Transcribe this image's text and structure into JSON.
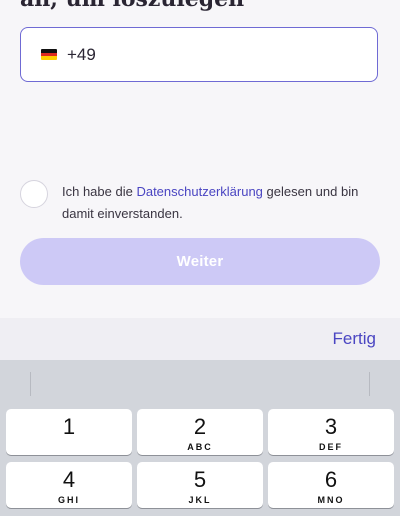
{
  "heading_fragment": "an, um loszulegen",
  "phone": {
    "country_flag_icon": "flag-germany-icon",
    "prefix": "+49"
  },
  "consent": {
    "text_before": "Ich habe die ",
    "link": "Datenschutzerklärung",
    "text_after": " gelesen und bin damit einverstanden.",
    "checked": false
  },
  "continue_button": "Weiter",
  "keyboard": {
    "done": "Fertig",
    "keys": [
      {
        "num": "1",
        "letters": ""
      },
      {
        "num": "2",
        "letters": "ABC"
      },
      {
        "num": "3",
        "letters": "DEF"
      },
      {
        "num": "4",
        "letters": "GHI"
      },
      {
        "num": "5",
        "letters": "JKL"
      },
      {
        "num": "6",
        "letters": "MNO"
      }
    ]
  },
  "colors": {
    "accent": "#4a45c2",
    "button_disabled": "#cdc9f6",
    "field_border": "#6f6ad4"
  }
}
